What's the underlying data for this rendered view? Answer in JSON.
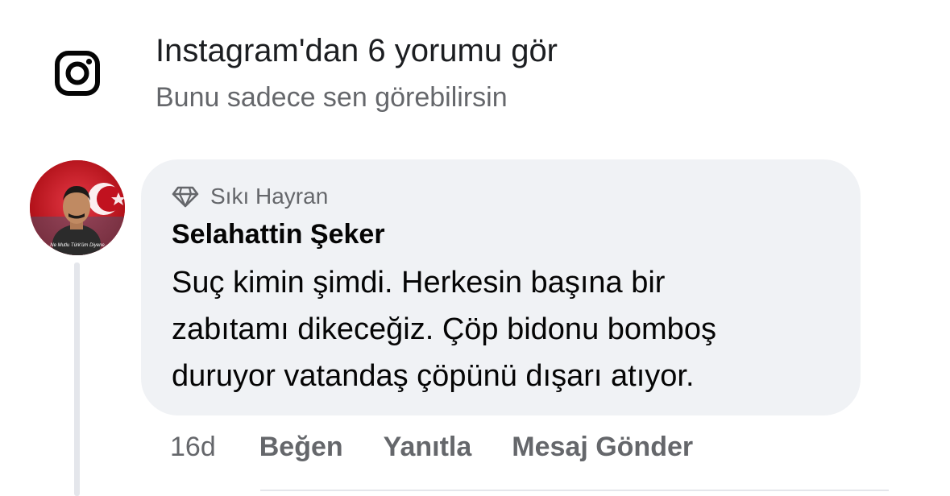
{
  "instagram": {
    "title": "Instagram'dan 6 yorumu gör",
    "subtitle": "Bunu sadece sen görebilirsin",
    "icon": "instagram-icon"
  },
  "comment": {
    "badge_icon": "diamond-icon",
    "badge": "Sıkı Hayran",
    "author": "Selahattin Şeker",
    "text_lines": [
      "Suç kimin şimdi. Herkesin başına bir",
      "zabıtamı dikeceğiz. Çöp bidonu bomboş",
      "duruyor vatandaş çöpünü dışarı atıyor."
    ],
    "avatar_overlay_text": "Ne Mutlu Türk'üm Diyene",
    "bubble_color": "#f0f2f5",
    "accent_color": "#c1121f"
  },
  "actions": {
    "time": "16d",
    "like": "Beğen",
    "reply": "Yanıtla",
    "send_message": "Mesaj Gönder"
  }
}
